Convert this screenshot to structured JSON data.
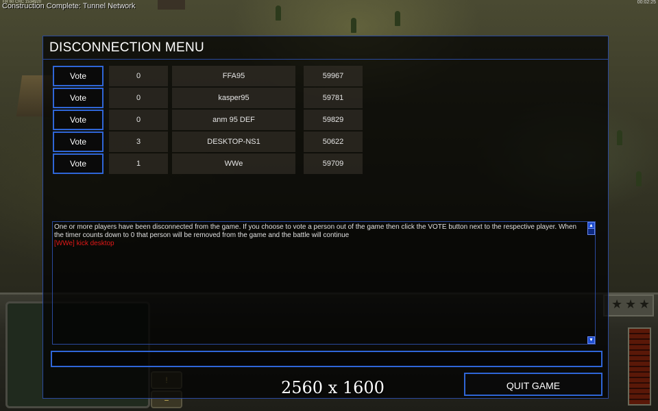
{
  "hud": {
    "message": "Construction Complete: Tunnel Network",
    "top_left_tiny": "FR 60 CRC 1534920",
    "clock": "00:02:25"
  },
  "dialog": {
    "title": "DISCONNECTION MENU",
    "vote_label": "Vote",
    "players": [
      {
        "votes": "0",
        "name": "FFA95",
        "port": "59967"
      },
      {
        "votes": "0",
        "name": "kasper95",
        "port": "59781"
      },
      {
        "votes": "0",
        "name": "anm 95 DEF",
        "port": "59829"
      },
      {
        "votes": "3",
        "name": "DESKTOP-NS1",
        "port": "50622"
      },
      {
        "votes": "1",
        "name": "WWe",
        "port": "59709"
      }
    ],
    "chat": {
      "info_line_1": "One or more players have been disconnected from the game. If you choose to vote a person out of the game then click the VOTE button next to the respective player. When",
      "info_line_2": " the timer counts down to 0 that person will be removed from the game and the battle will continue",
      "message": "[WWe] kick desktop"
    },
    "chat_input_value": "",
    "quit_label": "QUIT GAME"
  },
  "overlay": {
    "resolution": "2560 x 1600"
  },
  "colors": {
    "accent_blue": "#2f66d8",
    "chat_red": "#e01818"
  }
}
